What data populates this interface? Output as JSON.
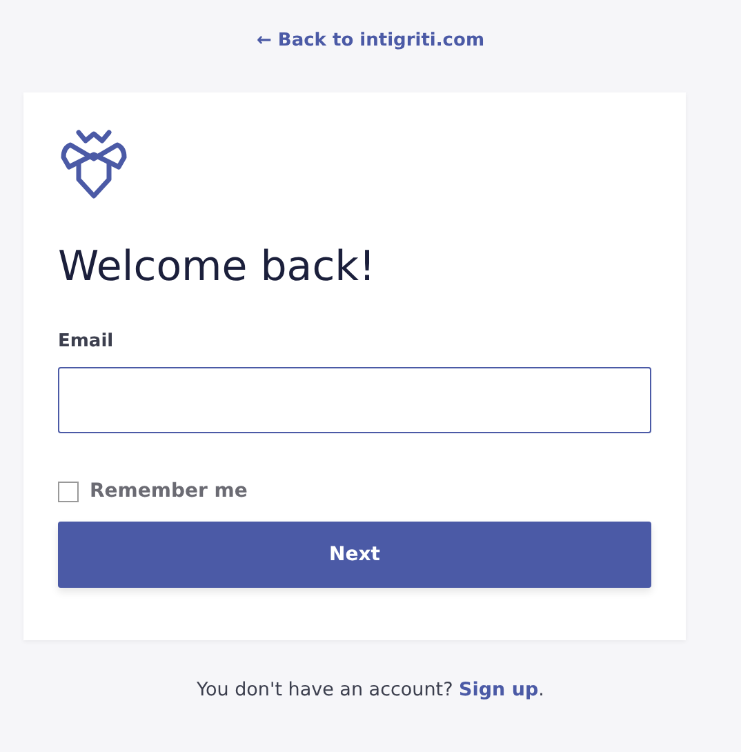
{
  "back_link": "← Back to intigriti.com",
  "card": {
    "title": "Welcome back!",
    "email": {
      "label": "Email"
    },
    "remember": {
      "label": "Remember me",
      "checked": false
    },
    "button": "Next"
  },
  "footer": {
    "text": "You don't have an account? ",
    "link": "Sign up",
    "suffix": "."
  }
}
